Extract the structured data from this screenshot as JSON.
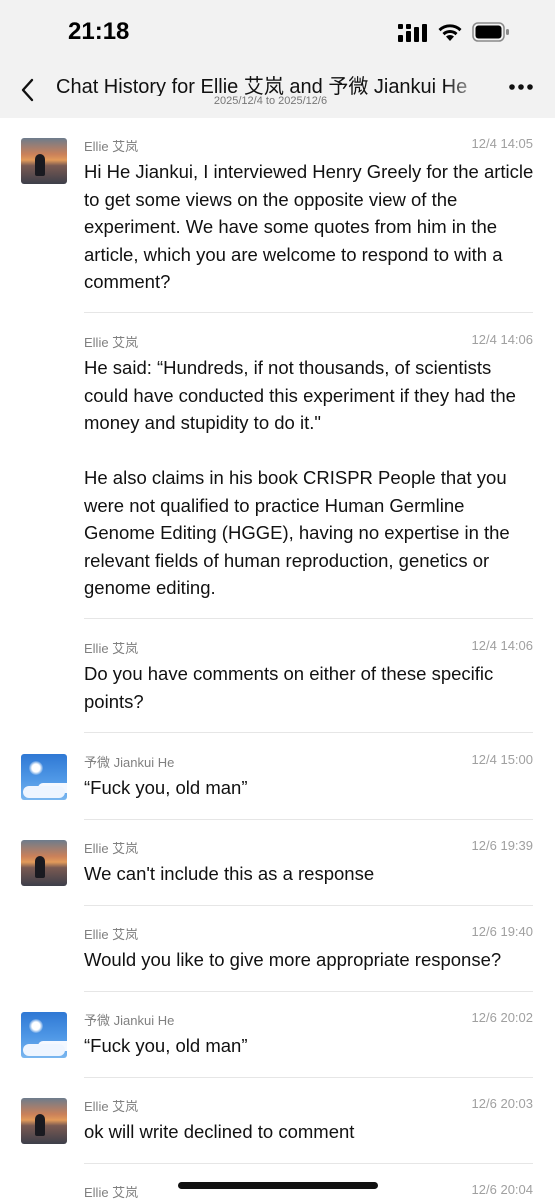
{
  "status_bar": {
    "time": "21:18"
  },
  "header": {
    "title": "Chat History for Ellie 艾岚 and 予微 Jiankui He",
    "subtitle": "2025/12/4 to 2025/12/6"
  },
  "messages": [
    {
      "sender": "Ellie 艾岚",
      "time": "12/4 14:05",
      "avatar": "ellie",
      "text": "Hi He Jiankui, I interviewed Henry Greely for the article to get some views on the opposite view of the experiment. We have some quotes from him in the article, which you are welcome to respond to with a comment?"
    },
    {
      "sender": "Ellie 艾岚",
      "time": "12/4 14:06",
      "avatar": "",
      "text": "He said: “Hundreds, if not thousands, of scientists could have conducted this experiment if they had the money and stupidity to do it.\"\n\nHe also claims in his book CRISPR People that you were not qualified to practice Human Germline Genome Editing (HGGE), having no expertise in the relevant fields of human reproduction, genetics or genome editing."
    },
    {
      "sender": "Ellie 艾岚",
      "time": "12/4 14:06",
      "avatar": "",
      "text": "Do you have comments on either of these specific points?"
    },
    {
      "sender": "予微 Jiankui He",
      "time": "12/4 15:00",
      "avatar": "jk",
      "text": "“Fuck you, old man”"
    },
    {
      "sender": "Ellie 艾岚",
      "time": "12/6 19:39",
      "avatar": "ellie",
      "text": "We can't include this as a response"
    },
    {
      "sender": "Ellie 艾岚",
      "time": "12/6 19:40",
      "avatar": "",
      "text": "Would you like to give more appropriate response?"
    },
    {
      "sender": "予微 Jiankui He",
      "time": "12/6 20:02",
      "avatar": "jk",
      "text": "“Fuck you, old man”"
    },
    {
      "sender": "Ellie 艾岚",
      "time": "12/6 20:03",
      "avatar": "ellie",
      "text": "ok will write declined to comment"
    },
    {
      "sender": "Ellie 艾岚",
      "time": "12/6 20:04",
      "avatar": "",
      "text": ""
    }
  ]
}
